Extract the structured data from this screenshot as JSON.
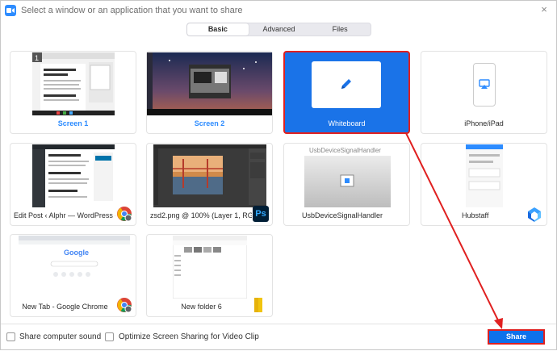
{
  "window": {
    "title": "Select a window or an application that you want to share",
    "close_glyph": "×"
  },
  "tabs": [
    {
      "label": "Basic",
      "active": true
    },
    {
      "label": "Advanced",
      "active": false
    },
    {
      "label": "Files",
      "active": false
    }
  ],
  "tiles": [
    {
      "label": "Screen 1"
    },
    {
      "label": "Screen 2"
    },
    {
      "label": "Whiteboard"
    },
    {
      "label": "iPhone/iPad"
    },
    {
      "label": "Edit Post ‹ Alphr — WordPress - ..."
    },
    {
      "label": "zsd2.png @ 100% (Layer 1, RGB/8..."
    },
    {
      "label": "UsbDeviceSignalHandler"
    },
    {
      "label": "Hubstaff"
    },
    {
      "label": "New Tab - Google Chrome"
    },
    {
      "label": "New folder 6"
    }
  ],
  "thumbs": {
    "screen1_number": "1",
    "usb_title": "UsbDeviceSignalHandler",
    "photoshop_badge": "Ps",
    "google_logo": "Google"
  },
  "footer": {
    "share_sound_label": "Share computer sound",
    "optimize_label": "Optimize Screen Sharing for Video Clip",
    "share_label": "Share"
  },
  "colors": {
    "accent": "#2D8CFF",
    "whiteboard_bg": "#1a73e8",
    "highlight_red": "#e02020",
    "share_button": "#0e71eb"
  },
  "icons": {
    "whiteboard": "pencil-icon",
    "iphone": "airplay-icon",
    "chrome": "chrome-icon",
    "photoshop": "photoshop-icon",
    "hubstaff": "hubstaff-icon",
    "folder": "folder-icon"
  }
}
